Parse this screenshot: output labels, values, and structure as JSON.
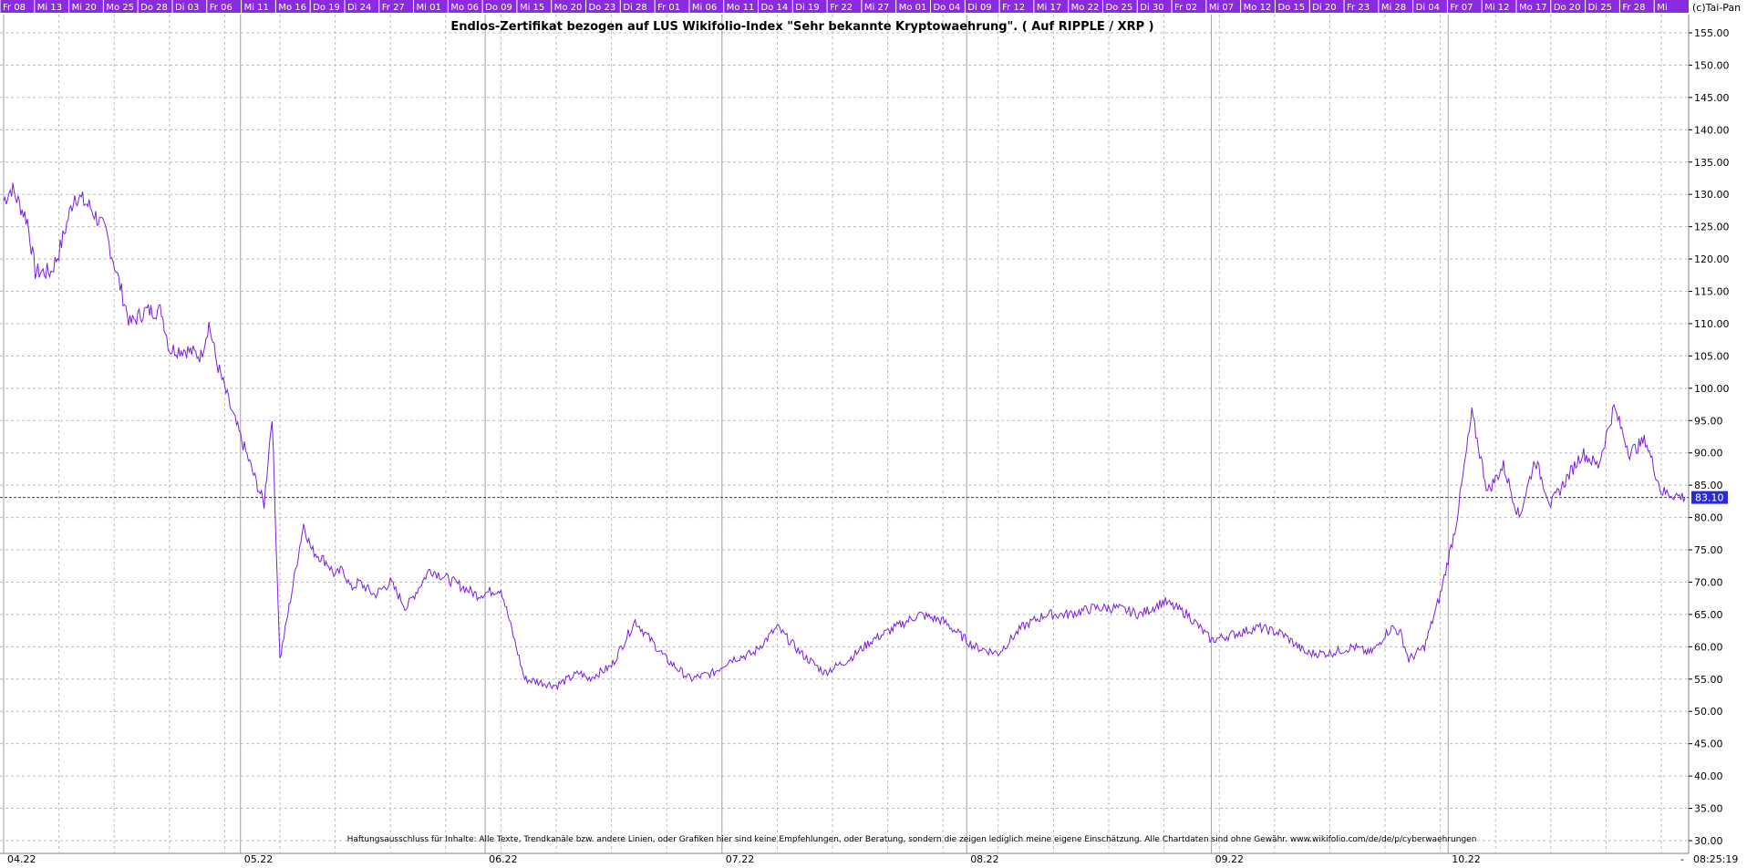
{
  "colors": {
    "line": "#7b1fe0",
    "last_line": "#2a2ad8",
    "badge_bg": "#2a2ad8",
    "header_bg": "#8a2be2",
    "header_text": "#ffffff",
    "grid": "#bdbdbd",
    "frame": "#808080"
  },
  "header": {
    "corner_label": "(c)Tai-Pan",
    "day_labels": [
      "Fr 08",
      "Mi 13",
      "Mi 20",
      "Mo 25",
      "Do 28",
      "Di 03",
      "Fr 06",
      "Mi 11",
      "Mo 16",
      "Do 19",
      "Di 24",
      "Fr 27",
      "Mi 01",
      "Mo 06",
      "Do 09",
      "Mi 15",
      "Mo 20",
      "Do 23",
      "Di 28",
      "Fr 01",
      "Mi 06",
      "Mo 11",
      "Do 14",
      "Di 19",
      "Fr 22",
      "Mi 27",
      "Mo 01",
      "Do 04",
      "Di 09",
      "Fr 12",
      "Mi 17",
      "Mo 22",
      "Do 25",
      "Di 30",
      "Fr 02",
      "Mi 07",
      "Mo 12",
      "Do 15",
      "Di 20",
      "Fr 23",
      "Mi 28",
      "Di 04",
      "Fr 07",
      "Mi 12",
      "Mo 17",
      "Do 20",
      "Di 25",
      "Fr 28",
      "Mi"
    ]
  },
  "footer": {
    "time_label": "08:25:19",
    "dash_label": "-"
  },
  "chart_data": {
    "type": "line",
    "title": "Endlos-Zertifikat bezogen auf LUS Wikifolio-Index \"Sehr bekannte Kryptowaehrung\". ( Auf RIPPLE / XRP )",
    "disclaimer": "Haftungsausschluss für Inhalte: Alle Texte, Trendkanäle bzw. andere Linien, oder Grafiken hier sind keine Empfehlungen, oder Beratung, sondern die zeigen lediglich meine eigene Einschätzung. Alle Chartdaten sind ohne Gewähr.  www.wikifolio.com/de/de/p/cyberwaehrungen",
    "x_ticks": [
      "04.22",
      "05.22",
      "06.22",
      "07.22",
      "08.22",
      "09.22",
      "10.22"
    ],
    "x_tick_dates": [
      "2022-04-01",
      "2022-05-01",
      "2022-06-01",
      "2022-07-01",
      "2022-08-01",
      "2022-09-01",
      "2022-10-01"
    ],
    "x_range": [
      "2022-04-01",
      "2022-10-31"
    ],
    "ylim": [
      30,
      155
    ],
    "y_ticks": [
      "30.00",
      "35.00",
      "40.00",
      "45.00",
      "50.00",
      "55.00",
      "60.00",
      "65.00",
      "70.00",
      "75.00",
      "80.00",
      "85.00",
      "90.00",
      "95.00",
      "100.00",
      "105.00",
      "110.00",
      "115.00",
      "120.00",
      "125.00",
      "130.00",
      "135.00",
      "140.00",
      "145.00",
      "150.00",
      "155.00"
    ],
    "grid": true,
    "last_value": 83.1,
    "last_label": "83.10",
    "series": [
      {
        "x": [
          "2022-04-01",
          "2022-04-02",
          "2022-04-04",
          "2022-04-05",
          "2022-04-07",
          "2022-04-08",
          "2022-04-10",
          "2022-04-12",
          "2022-04-14",
          "2022-04-17",
          "2022-04-19",
          "2022-04-21",
          "2022-04-22",
          "2022-04-24",
          "2022-04-26",
          "2022-04-27",
          "2022-04-28",
          "2022-04-30",
          "2022-05-02",
          "2022-05-04",
          "2022-05-05",
          "2022-05-06",
          "2022-05-07",
          "2022-05-08",
          "2022-05-09",
          "2022-05-10",
          "2022-05-11",
          "2022-05-12",
          "2022-05-13",
          "2022-05-14",
          "2022-05-15",
          "2022-05-16",
          "2022-05-18",
          "2022-05-20",
          "2022-05-22",
          "2022-05-25",
          "2022-05-28",
          "2022-05-31",
          "2022-06-03",
          "2022-06-06",
          "2022-06-10",
          "2022-06-13",
          "2022-06-14",
          "2022-06-17",
          "2022-06-20",
          "2022-06-24",
          "2022-06-27",
          "2022-06-30",
          "2022-07-02",
          "2022-07-05",
          "2022-07-08",
          "2022-07-11",
          "2022-07-14",
          "2022-07-17",
          "2022-07-20",
          "2022-07-23",
          "2022-07-26",
          "2022-07-29",
          "2022-08-02",
          "2022-08-05",
          "2022-08-08",
          "2022-08-11",
          "2022-08-14",
          "2022-08-17",
          "2022-08-20",
          "2022-08-23",
          "2022-08-26",
          "2022-08-29",
          "2022-09-01",
          "2022-09-04",
          "2022-09-07",
          "2022-09-10",
          "2022-09-13",
          "2022-09-16",
          "2022-09-19",
          "2022-09-21",
          "2022-09-22",
          "2022-09-23",
          "2022-09-24",
          "2022-09-25",
          "2022-09-26",
          "2022-09-28",
          "2022-09-30",
          "2022-10-02",
          "2022-10-04",
          "2022-10-06",
          "2022-10-08",
          "2022-10-10",
          "2022-10-12",
          "2022-10-14",
          "2022-10-16",
          "2022-10-18",
          "2022-10-20",
          "2022-10-22",
          "2022-10-24",
          "2022-10-26",
          "2022-10-28",
          "2022-10-31"
        ],
        "values": [
          129,
          131,
          126,
          118,
          118,
          121,
          130,
          128,
          124,
          110,
          112,
          112,
          106,
          106,
          105,
          110,
          104,
          96,
          89,
          82,
          96,
          58,
          65,
          72,
          79,
          75,
          74,
          73,
          71,
          72,
          69,
          70,
          68,
          70,
          66,
          72,
          70,
          68,
          69,
          55,
          54,
          56,
          55,
          57,
          64,
          58,
          55,
          56,
          58,
          59,
          63,
          59,
          56,
          58,
          61,
          63,
          65,
          64,
          60,
          59,
          63,
          65,
          65,
          66,
          66,
          65,
          67,
          65,
          61,
          62,
          63,
          62,
          59,
          59,
          60,
          59,
          60,
          62,
          63,
          62,
          58,
          60,
          68,
          79,
          96,
          84,
          88,
          80,
          89,
          82,
          86,
          90,
          88,
          97,
          90,
          92,
          84,
          83.1
        ]
      }
    ]
  }
}
